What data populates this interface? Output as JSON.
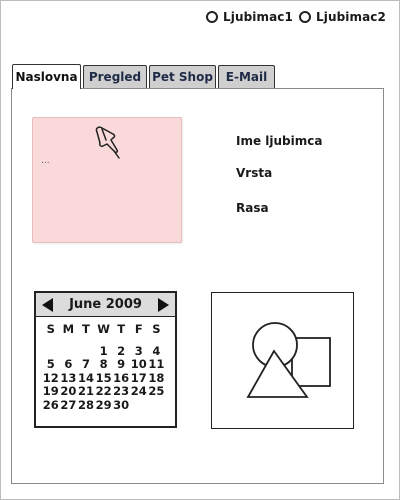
{
  "pet_selector": {
    "options": [
      "Ljubimac1",
      "Ljubimac2"
    ]
  },
  "tabs": [
    {
      "label": "Naslovna",
      "active": true
    },
    {
      "label": "Pregled",
      "active": false
    },
    {
      "label": "Pet Shop",
      "active": false
    },
    {
      "label": "E-Mail",
      "active": false
    }
  ],
  "note": {
    "text": "...",
    "color": "#f9d9d9",
    "icon": "pushpin-icon"
  },
  "pet_info": {
    "name_label": "Ime ljubimca",
    "species_label": "Vrsta",
    "breed_label": "Rasa"
  },
  "calendar": {
    "title": "June 2009",
    "weekdays": [
      "S",
      "M",
      "T",
      "W",
      "T",
      "F",
      "S"
    ],
    "weeks": [
      [
        "",
        "",
        "",
        "1",
        "2",
        "3",
        "4"
      ],
      [
        "5",
        "6",
        "7",
        "8",
        "9",
        "10",
        "11"
      ],
      [
        "12",
        "13",
        "14",
        "15",
        "16",
        "17",
        "18"
      ],
      [
        "19",
        "20",
        "21",
        "22",
        "23",
        "24",
        "25"
      ],
      [
        "26",
        "27",
        "28",
        "29",
        "30",
        "",
        ""
      ]
    ]
  },
  "image_placeholder": {
    "icon": "shapes-placeholder-icon"
  }
}
